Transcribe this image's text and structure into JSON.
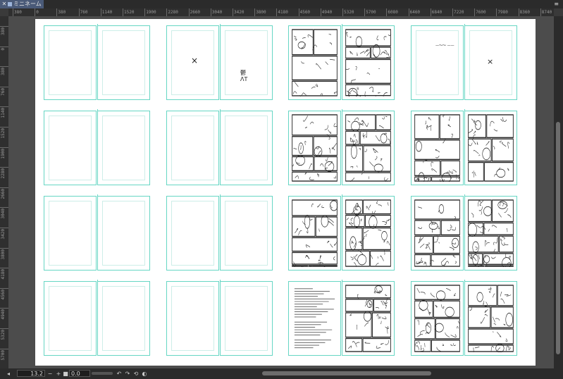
{
  "tab": {
    "close": "✕",
    "title": "ミニネーム",
    "menu": "≡"
  },
  "rulers": {
    "horizontal": [
      "380",
      "0",
      "380",
      "760",
      "1140",
      "1520",
      "1900",
      "2280",
      "2660",
      "3040",
      "3420",
      "3800",
      "4180",
      "4560",
      "4940",
      "5320",
      "5700",
      "6080",
      "6460",
      "6840",
      "7220",
      "7600",
      "7980",
      "8360",
      "8740"
    ],
    "vertical": [
      "380",
      "0",
      "380",
      "760",
      "1140",
      "1520",
      "1900",
      "2280",
      "2660",
      "3040",
      "3420",
      "3800",
      "4180",
      "4560",
      "4940",
      "5320",
      "5700",
      "6080"
    ]
  },
  "pages": {
    "spread_2_1_left_mark": "×",
    "spread_2_1_right_mark": "鬱\nΛT",
    "spread_4_1_left_mark": "—～～ ——",
    "spread_4_1_right_mark": "×"
  },
  "statusbar": {
    "zoom_value": "13.2",
    "zoom_out": "−",
    "zoom_in": "+",
    "angle_value": "0.0",
    "rotate_left": "↶",
    "rotate_right": "↷",
    "reset": "⟲",
    "flip": "◐",
    "stop": "■"
  },
  "colors": {
    "guide": "#66d6c4",
    "sheet": "#ffffff",
    "workspace": "#4c4c4c",
    "tab": "#4a5a78"
  }
}
